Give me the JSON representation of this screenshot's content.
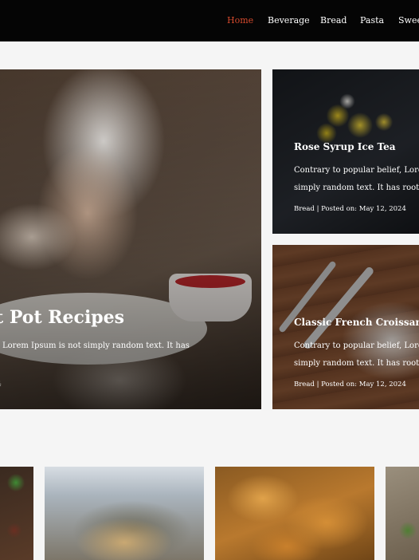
{
  "nav": {
    "items": [
      "Home",
      "Beverage",
      "Bread",
      "Pasta",
      "Sweet"
    ],
    "active_index": 0,
    "active_color": "#d64a2d"
  },
  "hero": {
    "title": "t Pot Recipes",
    "excerpt": "Lorem Ipsum is not simply random text. It has",
    "meta": "4"
  },
  "cards": [
    {
      "title": "Rose Syrup Ice Tea",
      "excerpt_line1": "Contrary to popular belief, Lore",
      "excerpt_line2": "simply random text. It has roots",
      "category": "Bread",
      "separator": "|",
      "posted": "Posted on: May 12, 2024"
    },
    {
      "title": "Classic French Croissant",
      "excerpt_line1": "Contrary to popular belief, Lore",
      "excerpt_line2": "simply random text. It has roots",
      "category": "Bread",
      "separator": "|",
      "posted": "Posted on: May 12, 2024"
    }
  ],
  "thumbnails": [
    "salad-dish-image",
    "pasta-bowl-image",
    "croissants-image",
    "garnish-dish-image"
  ]
}
